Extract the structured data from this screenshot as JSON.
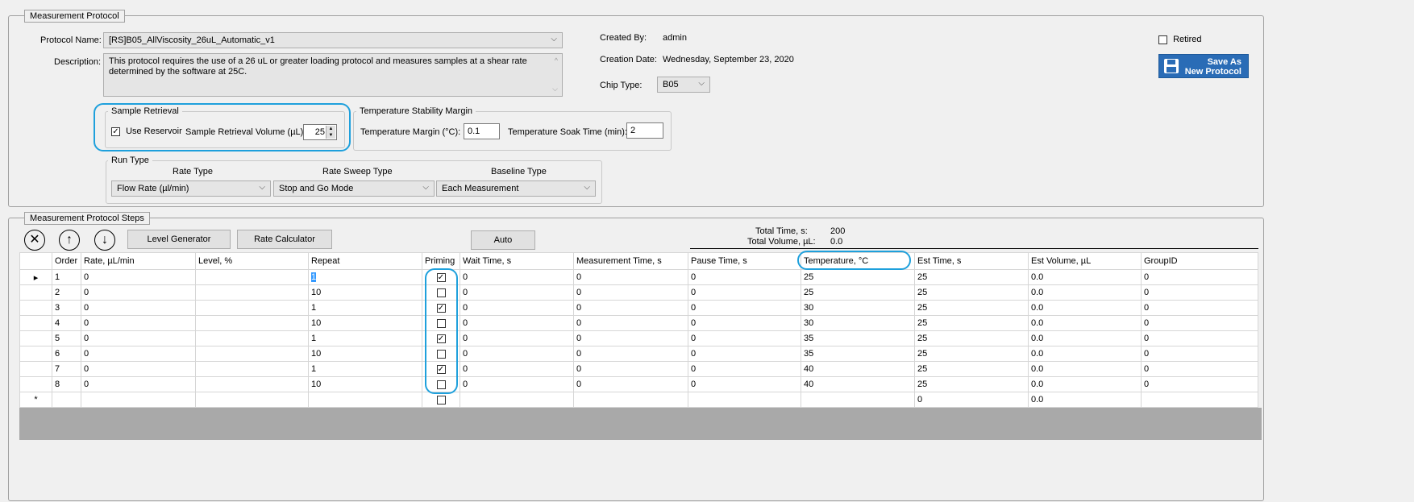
{
  "protocol_group": {
    "legend": "Measurement Protocol",
    "protocol_name_label": "Protocol Name:",
    "protocol_name_value": "[RS]B05_AllViscosity_26uL_Automatic_v1",
    "description_label": "Description:",
    "description_value": "This protocol requires the use of a 26 uL or greater loading protocol and measures samples at a shear rate determined by the software at 25C.",
    "created_by_label": "Created By:",
    "created_by_value": "admin",
    "creation_date_label": "Creation Date:",
    "creation_date_value": "Wednesday, September 23, 2020",
    "chip_type_label": "Chip Type:",
    "chip_type_value": "B05",
    "retired_label": "Retired",
    "save_as_line1": "Save As",
    "save_as_line2": "New Protocol"
  },
  "sample_retrieval": {
    "legend": "Sample Retrieval",
    "use_reservoir_label": "Use Reservoir",
    "use_reservoir_checked": true,
    "volume_label": "Sample Retrieval Volume (µL):",
    "volume_value": "25"
  },
  "temperature_stability": {
    "legend": "Temperature Stability Margin",
    "margin_label": "Temperature Margin (°C):",
    "margin_value": "0.1",
    "soak_label": "Temperature Soak Time (min):",
    "soak_value": "2"
  },
  "run_type": {
    "legend": "Run Type",
    "rate_type_label": "Rate Type",
    "rate_type_value": "Flow Rate (µl/min)",
    "rate_sweep_label": "Rate Sweep Type",
    "rate_sweep_value": "Stop and Go Mode",
    "baseline_label": "Baseline Type",
    "baseline_value": "Each Measurement"
  },
  "steps_group": {
    "legend": "Measurement Protocol Steps",
    "level_generator_label": "Level Generator",
    "rate_calculator_label": "Rate Calculator",
    "auto_label": "Auto",
    "total_time_label": "Total Time, s:",
    "total_time_value": "200",
    "total_volume_label": "Total Volume, µL:",
    "total_volume_value": "0.0"
  },
  "grid": {
    "columns": [
      "Order",
      "Rate, µL/min",
      "Level, %",
      "Repeat",
      "Priming",
      "Wait Time, s",
      "Measurement Time, s",
      "Pause Time, s",
      "Temperature, °C",
      "Est Time, s",
      "Est Volume, µL",
      "GroupID"
    ],
    "rows": [
      {
        "order": "1",
        "rate": "0",
        "level": "",
        "repeat": "1",
        "priming": true,
        "wait": "0",
        "meas": "0",
        "pause": "0",
        "temp": "25",
        "est_time": "25",
        "est_vol": "0.0",
        "group": "0"
      },
      {
        "order": "2",
        "rate": "0",
        "level": "",
        "repeat": "10",
        "priming": false,
        "wait": "0",
        "meas": "0",
        "pause": "0",
        "temp": "25",
        "est_time": "25",
        "est_vol": "0.0",
        "group": "0"
      },
      {
        "order": "3",
        "rate": "0",
        "level": "",
        "repeat": "1",
        "priming": true,
        "wait": "0",
        "meas": "0",
        "pause": "0",
        "temp": "30",
        "est_time": "25",
        "est_vol": "0.0",
        "group": "0"
      },
      {
        "order": "4",
        "rate": "0",
        "level": "",
        "repeat": "10",
        "priming": false,
        "wait": "0",
        "meas": "0",
        "pause": "0",
        "temp": "30",
        "est_time": "25",
        "est_vol": "0.0",
        "group": "0"
      },
      {
        "order": "5",
        "rate": "0",
        "level": "",
        "repeat": "1",
        "priming": true,
        "wait": "0",
        "meas": "0",
        "pause": "0",
        "temp": "35",
        "est_time": "25",
        "est_vol": "0.0",
        "group": "0"
      },
      {
        "order": "6",
        "rate": "0",
        "level": "",
        "repeat": "10",
        "priming": false,
        "wait": "0",
        "meas": "0",
        "pause": "0",
        "temp": "35",
        "est_time": "25",
        "est_vol": "0.0",
        "group": "0"
      },
      {
        "order": "7",
        "rate": "0",
        "level": "",
        "repeat": "1",
        "priming": true,
        "wait": "0",
        "meas": "0",
        "pause": "0",
        "temp": "40",
        "est_time": "25",
        "est_vol": "0.0",
        "group": "0"
      },
      {
        "order": "8",
        "rate": "0",
        "level": "",
        "repeat": "10",
        "priming": false,
        "wait": "0",
        "meas": "0",
        "pause": "0",
        "temp": "40",
        "est_time": "25",
        "est_vol": "0.0",
        "group": "0"
      }
    ],
    "new_row": {
      "est_time": "0",
      "est_vol": "0.0"
    },
    "current_row_marker": "▸",
    "new_row_marker": "*"
  },
  "colors": {
    "highlight": "#1ea0dc",
    "save_button": "#2a6cb6",
    "grid_empty": "#a9a9a9"
  }
}
